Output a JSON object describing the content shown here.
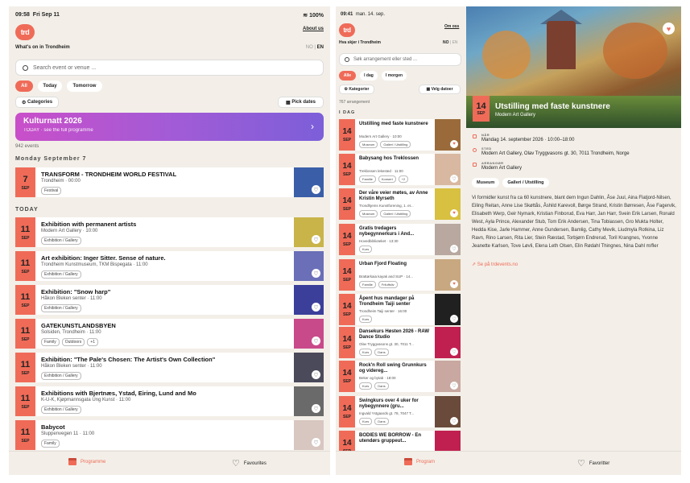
{
  "left": {
    "status": {
      "time": "09:58",
      "date": "Fri Sep 11",
      "battery": "100%"
    },
    "logo": "trd",
    "about": "About us",
    "tagline": "What's on in Trondheim",
    "lang": [
      "NO",
      "EN"
    ],
    "search_placeholder": "Search event or venue ...",
    "chips": [
      "All",
      "Today",
      "Tomorrow"
    ],
    "categories": "Categories",
    "pick_dates": "Pick dates",
    "banner": {
      "title": "Kulturnatt 2026",
      "subtitle": "TODAY · see the full programme"
    },
    "count": "942 events",
    "section1": "Monday September 7",
    "section2": "TODAY",
    "events": [
      {
        "day": "7",
        "mon": "SEP",
        "title": "TRANSFORM - TRONDHEIM WORLD FESTIVAL",
        "venue": "Trondheim · 00:00",
        "tags": [
          "Festival"
        ]
      },
      {
        "day": "11",
        "mon": "SEP",
        "title": "Exhibition with permanent artists",
        "venue": "Modern Art Gallery · 10:00",
        "tags": [
          "Exhibition / Gallery"
        ]
      },
      {
        "day": "11",
        "mon": "SEP",
        "title": "Art exhibition: Inger Sitter. Sense of nature.",
        "venue": "Trondheim Kunstmuseum, TKM Bispegata · 11:00",
        "tags": [
          "Exhibition / Gallery"
        ]
      },
      {
        "day": "11",
        "mon": "SEP",
        "title": "Exhibition: \"Snow harp\"",
        "venue": "Håkon Bleken senter · 11:00",
        "tags": [
          "Exhibition / Gallery"
        ]
      },
      {
        "day": "11",
        "mon": "SEP",
        "title": "GATEKUNSTLANDSBYEN",
        "venue": "Solsiden, Trondheim · 11:00",
        "tags": [
          "Family",
          "Outdoors",
          "+1"
        ]
      },
      {
        "day": "11",
        "mon": "SEP",
        "title": "Exhibition: \"The Pale's Chosen: The Artist's Own Collection\"",
        "venue": "Håkon Bleken senter · 11:00",
        "tags": [
          "Exhibition / Gallery"
        ]
      },
      {
        "day": "11",
        "mon": "SEP",
        "title": "Exhibitions with Bjertnæs, Ystad, Eiring, Lund and Mo",
        "venue": "K-U-K, Kjøpmannsgata Ung Kunst · 11:00",
        "tags": [
          "Exhibition / Gallery"
        ]
      },
      {
        "day": "11",
        "mon": "SEP",
        "title": "Babycot",
        "venue": "Sluppenvegen 11 · 11:00",
        "tags": [
          "Family"
        ]
      }
    ],
    "tabs": [
      "Programme",
      "Favourites"
    ]
  },
  "right": {
    "status": {
      "time": "09:41",
      "date": "man. 14. sep."
    },
    "logo": "trd",
    "about": "Om oss",
    "tagline": "Hva skjer i Trondheim",
    "lang": [
      "NO",
      "EN"
    ],
    "search_placeholder": "Søk arrangement eller sted ...",
    "chips": [
      "Alle",
      "I dag",
      "I morgen"
    ],
    "categories": "Kategorier",
    "pick_dates": "Velg datoer",
    "count": "767 arrangement",
    "section": "I DAG",
    "events": [
      {
        "day": "14",
        "mon": "SEP",
        "title": "Utstilling med faste kunstnere",
        "venue": "Modern Art Gallery · 10:00",
        "tags": [
          "Museum",
          "Galleri / Utstilling"
        ]
      },
      {
        "day": "14",
        "mon": "SEP",
        "title": "Babysang hos Treklossen",
        "venue": "Treklossen lekested · 11:00",
        "tags": [
          "Familie",
          "Konsert",
          "+2"
        ]
      },
      {
        "day": "14",
        "mon": "SEP",
        "title": "Der våre veier møtes, av Anne Kristin Myrseth",
        "venue": "Trondhjems Kunstforening, 1. et...",
        "tags": [
          "Museum",
          "Galleri / Utstilling"
        ]
      },
      {
        "day": "14",
        "mon": "SEP",
        "title": "Gratis tredagers nybegynnerkurs i And...",
        "venue": "Hovedbiblioteket · 13:30",
        "tags": [
          "Kurs"
        ]
      },
      {
        "day": "14",
        "mon": "SEP",
        "title": "Urban Fjord Floating",
        "venue": "Brattørkaia kayak and SUP · 14...",
        "tags": [
          "Familie",
          "Friluftsliv"
        ]
      },
      {
        "day": "14",
        "mon": "SEP",
        "title": "Åpent hus mandager på Trondheim Taiji senter",
        "venue": "Trondheim Taiji senter · 16:00",
        "tags": [
          "Kurs"
        ]
      },
      {
        "day": "14",
        "mon": "SEP",
        "title": "Dansekurs Høsten 2026 - RAW Dance Studio",
        "venue": "Olav Tryggvasons gt. 30, 7011 T...",
        "tags": [
          "Kurs",
          "Dans"
        ]
      },
      {
        "day": "14",
        "mon": "SEP",
        "title": "Rock'n Roll swing Grunnkurs og videreg...",
        "venue": "Beker og bytab · 18:00",
        "tags": [
          "Kurs",
          "Dans"
        ]
      },
      {
        "day": "14",
        "mon": "SEP",
        "title": "Swingkurs over 4 uker for nybegynnere (gru...",
        "venue": "Ingvald Ystgaards gt. 78, 7047 T...",
        "tags": [
          "Kurs",
          "Dans"
        ]
      },
      {
        "day": "14",
        "mon": "SEP",
        "title": "BODIES WE BORROW - En utendørs gruppeut...",
        "venue": "",
        "tags": []
      }
    ],
    "detail": {
      "day": "14",
      "mon": "SEP",
      "title": "Utstilling med faste kunstnere",
      "venue": "Modern Art Gallery",
      "when_label": "NÅR",
      "when": "Mandag 14. september 2026 · 10:00–18:00",
      "place_label": "STED",
      "place": "Modern Art Gallery, Olav Tryggvasons gt. 30, 7011 Trondheim, Norge",
      "org_label": "ARRANGØR",
      "org": "Modern Art Gallery",
      "tags": [
        "Museum",
        "Galleri / Utstilling"
      ],
      "description": "Vi formidler kunst fra ca 60 kunstnere, blant dem Ingun Dahlin, Åse Juul, Aina Flatjord-Nilsen, Eiling Reitan, Anne Lise Skøttås, Åshild Karevoll, Børge Strand, Kristin Børresen, Åse Fagervik, Elisabeth Werp, Geir Nymark, Kristian Finborud, Eva Harr, Jan Harr, Svein Erik Larsen, Ronald West, Ayla Prince, Alexander Stub, Tom Erik Andersen, Tina Tobiassen, Gro Mukta Holter, Hedda Kise, Jarle Hammer, Anne Gundersen, Bamlig, Cathy Mevik, Liudmyla Rotkina, Liz Ravn, Rino Larsen, Rita Lier, Stein Ræstad, Torbjørn Endrerud, Toril Krangnes, Yvonne Jeanette Karlsen, Tove Løvli, Elena Leth Olsen, Elin Rødahl Thingnes, Nina Dahl m/fler",
      "link": "Se på trdevents.no"
    },
    "tabs": [
      "Program",
      "Favoritter"
    ]
  },
  "colors": {
    "accent": "#ef6b58",
    "bg": "#f3efe8"
  }
}
